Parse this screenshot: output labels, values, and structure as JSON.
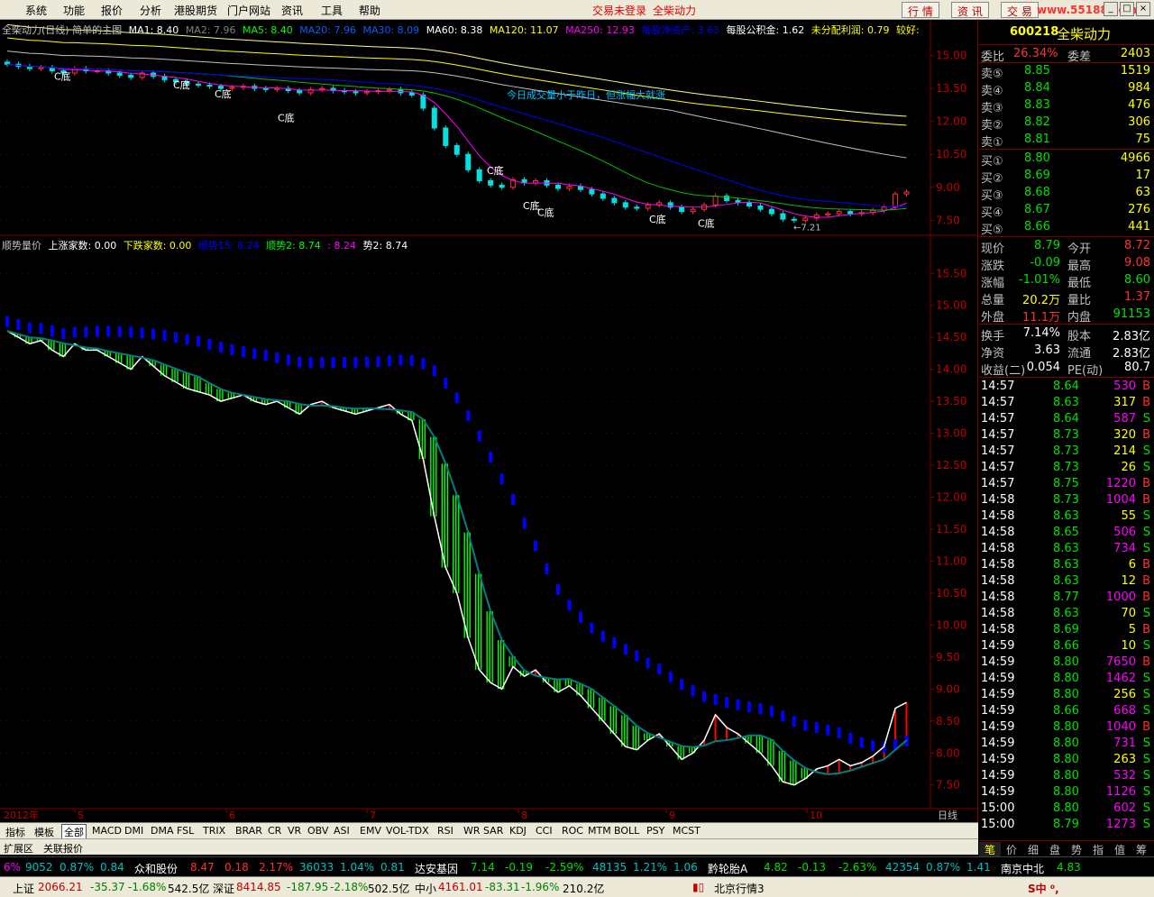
{
  "menu": {
    "items": [
      "系统",
      "功能",
      "报价",
      "分析",
      "港股期货",
      "门户网站",
      "资讯",
      "工具",
      "帮助"
    ],
    "status1": "交易未登录",
    "status2": "全柴动力",
    "right_buttons": [
      "行 情",
      "资 讯",
      "交 易"
    ],
    "watermark": "www.55188.com",
    "window_icons": [
      "minimize-icon",
      "restore-icon",
      "close-icon"
    ]
  },
  "main_header": {
    "title": "全柴动力(日线) 简单的主图",
    "ma1": "MA1: 8.40",
    "ma2": "MA2: 7.96",
    "ma5": "MA5: 8.40",
    "ma20": "MA20: 7.96",
    "ma30": "MA30: 8.09",
    "ma60": "MA60: 8.38",
    "ma120": "MA120: 11.07",
    "ma250": "MA250: 12.93",
    "nav": "每股净资产: 3.63",
    "reserve": "每股公积金: 1.62",
    "undist": "未分配利润: 0.79",
    "rating": "较好:"
  },
  "main_annotations": {
    "c_label": "C底",
    "note": "今日成交量小于昨日，但涨幅大就涨",
    "low_label": "←7.21"
  },
  "sub_header": {
    "title": "顺势量价",
    "up": "上涨家数: 0.00",
    "down": "下跌家数: 0.00",
    "s15": "顺势15: 8.24",
    "s2": "顺势2: 8.74",
    "s3": ": 8.24",
    "s4": "势2: 8.74"
  },
  "chart_data": {
    "type": "candlestick-with-indicator",
    "main_axis": [
      "15.00",
      "13.50",
      "12.00",
      "10.50",
      "9.00",
      "7.50"
    ],
    "sub_axis": [
      "15.50",
      "15.00",
      "14.50",
      "14.00",
      "13.50",
      "13.00",
      "12.50",
      "12.00",
      "11.50",
      "11.00",
      "10.50",
      "10.00",
      "9.50",
      "9.00",
      "8.50",
      "8.00",
      "7.50"
    ],
    "x_labels": [
      "2012年",
      "5",
      "6",
      "7",
      "8",
      "9",
      "10",
      "日线"
    ],
    "main_ylim": [
      6.9,
      15.8
    ],
    "sub_ylim": [
      7.2,
      15.8
    ],
    "close": [
      14.6,
      14.5,
      14.4,
      14.45,
      14.3,
      14.2,
      14.4,
      14.3,
      14.3,
      14.2,
      14.1,
      14.0,
      14.2,
      14.05,
      13.9,
      13.8,
      13.7,
      13.65,
      13.6,
      13.5,
      13.55,
      13.6,
      13.5,
      13.45,
      13.5,
      13.4,
      13.3,
      13.45,
      13.5,
      13.4,
      13.35,
      13.3,
      13.35,
      13.4,
      13.45,
      13.3,
      13.2,
      12.6,
      11.7,
      10.9,
      10.5,
      9.8,
      9.3,
      9.1,
      9.0,
      9.35,
      9.2,
      9.3,
      9.1,
      8.95,
      9.05,
      8.9,
      8.7,
      8.5,
      8.3,
      8.1,
      8.05,
      8.2,
      8.3,
      8.1,
      7.9,
      8.0,
      8.2,
      8.6,
      8.4,
      8.3,
      8.15,
      8.0,
      7.8,
      7.55,
      7.5,
      7.6,
      7.75,
      7.8,
      7.9,
      7.8,
      7.85,
      7.95,
      8.1,
      8.7,
      8.79
    ],
    "ma_series": [
      "MA5",
      "MA20",
      "MA30",
      "MA60",
      "MA120",
      "MA250"
    ],
    "ma_colors": [
      "#ff00ff",
      "#00c000",
      "#0000ff",
      "#c0c0c0",
      "#ffff00",
      "#ffff80"
    ],
    "sub_series": [
      "white-line",
      "teal-line",
      "blue-bars",
      "green-bars"
    ]
  },
  "quote": {
    "code": "600218",
    "name": "全柴动力",
    "ratio_label": "委比",
    "ratio": "26.34%",
    "diff_label": "委差",
    "diff": "2403",
    "sells": [
      {
        "label": "卖⑤",
        "price": "8.85",
        "vol": "1519"
      },
      {
        "label": "卖④",
        "price": "8.84",
        "vol": "984"
      },
      {
        "label": "卖③",
        "price": "8.83",
        "vol": "476"
      },
      {
        "label": "卖②",
        "price": "8.82",
        "vol": "306"
      },
      {
        "label": "卖①",
        "price": "8.81",
        "vol": "75"
      }
    ],
    "buys": [
      {
        "label": "买①",
        "price": "8.80",
        "vol": "4966"
      },
      {
        "label": "买②",
        "price": "8.69",
        "vol": "17"
      },
      {
        "label": "买③",
        "price": "8.68",
        "vol": "63"
      },
      {
        "label": "买④",
        "price": "8.67",
        "vol": "276"
      },
      {
        "label": "买⑤",
        "price": "8.66",
        "vol": "441"
      }
    ],
    "stats": [
      [
        "现价",
        "8.79",
        "今开",
        "8.72",
        "dn",
        "up"
      ],
      [
        "涨跌",
        "-0.09",
        "最高",
        "9.08",
        "dn",
        "up"
      ],
      [
        "涨幅",
        "-1.01%",
        "最低",
        "8.60",
        "dn",
        "dn"
      ],
      [
        "总量",
        "20.2万",
        "量比",
        "1.37",
        "yl",
        "up"
      ],
      [
        "外盘",
        "11.1万",
        "内盘",
        "91153",
        "up",
        "dn"
      ]
    ],
    "stats2": [
      [
        "换手",
        "7.14%",
        "股本",
        "2.83亿"
      ],
      [
        "净资",
        "3.63",
        "流通",
        "2.83亿"
      ],
      [
        "收益(二)",
        "0.054",
        "PE(动)",
        "80.7"
      ]
    ],
    "ticks": [
      [
        "14:57",
        "8.64",
        "530",
        "B",
        "dn",
        "mg"
      ],
      [
        "14:57",
        "8.63",
        "317",
        "B",
        "dn",
        "yl"
      ],
      [
        "14:57",
        "8.64",
        "587",
        "S",
        "dn",
        "mg"
      ],
      [
        "14:57",
        "8.73",
        "320",
        "B",
        "dn",
        "yl"
      ],
      [
        "14:57",
        "8.73",
        "214",
        "S",
        "dn",
        "yl"
      ],
      [
        "14:57",
        "8.73",
        "26",
        "S",
        "dn",
        "yl"
      ],
      [
        "14:57",
        "8.75",
        "1220",
        "B",
        "dn",
        "mg"
      ],
      [
        "14:58",
        "8.73",
        "1004",
        "B",
        "dn",
        "mg"
      ],
      [
        "14:58",
        "8.63",
        "55",
        "S",
        "dn",
        "yl"
      ],
      [
        "14:58",
        "8.65",
        "506",
        "S",
        "dn",
        "mg"
      ],
      [
        "14:58",
        "8.63",
        "734",
        "S",
        "dn",
        "mg"
      ],
      [
        "14:58",
        "8.63",
        "6",
        "B",
        "dn",
        "yl"
      ],
      [
        "14:58",
        "8.63",
        "12",
        "B",
        "dn",
        "yl"
      ],
      [
        "14:58",
        "8.77",
        "1000",
        "B",
        "dn",
        "mg"
      ],
      [
        "14:58",
        "8.63",
        "70",
        "S",
        "dn",
        "yl"
      ],
      [
        "14:58",
        "8.69",
        "5",
        "B",
        "dn",
        "yl"
      ],
      [
        "14:59",
        "8.66",
        "10",
        "S",
        "dn",
        "yl"
      ],
      [
        "14:59",
        "8.80",
        "7650",
        "B",
        "dn",
        "mg"
      ],
      [
        "14:59",
        "8.80",
        "1462",
        "S",
        "dn",
        "mg"
      ],
      [
        "14:59",
        "8.80",
        "256",
        "S",
        "dn",
        "yl"
      ],
      [
        "14:59",
        "8.66",
        "668",
        "S",
        "dn",
        "mg"
      ],
      [
        "14:59",
        "8.80",
        "1040",
        "B",
        "dn",
        "mg"
      ],
      [
        "14:59",
        "8.80",
        "731",
        "S",
        "dn",
        "mg"
      ],
      [
        "14:59",
        "8.80",
        "263",
        "S",
        "dn",
        "yl"
      ],
      [
        "14:59",
        "8.80",
        "532",
        "S",
        "dn",
        "mg"
      ],
      [
        "14:59",
        "8.80",
        "1126",
        "S",
        "dn",
        "mg"
      ],
      [
        "15:00",
        "8.80",
        "602",
        "S",
        "dn",
        "mg"
      ],
      [
        "15:00",
        "8.79",
        "1273",
        "S",
        "dn",
        "mg"
      ]
    ]
  },
  "right_tabs": [
    "笔",
    "价",
    "细",
    "盘",
    "势",
    "指",
    "值",
    "筹"
  ],
  "indicators": [
    "指标",
    "模板",
    "全部",
    "MACD",
    "DMI",
    "DMA",
    "FSL",
    "TRIX",
    "BRAR",
    "CR",
    "VR",
    "OBV",
    "ASI",
    "EMV",
    "VOL-TDX",
    "RSI",
    "WR",
    "SAR",
    "KDJ",
    "CCI",
    "ROC",
    "MTM",
    "BOLL",
    "PSY",
    "MCST"
  ],
  "ext_tabs": [
    "扩展区",
    "关联报价"
  ],
  "ticker": [
    {
      "t": "6%",
      "c": "mg"
    },
    {
      "t": "9052",
      "c": "cy"
    },
    {
      "t": "0.87%",
      "c": "cy"
    },
    {
      "t": "0.84",
      "c": "cy"
    },
    {
      "t": "众和股份",
      "c": "wh"
    },
    {
      "t": "8.47",
      "c": "up"
    },
    {
      "t": "0.18",
      "c": "up"
    },
    {
      "t": "2.17%",
      "c": "up"
    },
    {
      "t": "36033",
      "c": "cy"
    },
    {
      "t": "1.04%",
      "c": "cy"
    },
    {
      "t": "0.81",
      "c": "cy"
    },
    {
      "t": "达安基因",
      "c": "wh"
    },
    {
      "t": "7.14",
      "c": "dn"
    },
    {
      "t": "-0.19",
      "c": "dn"
    },
    {
      "t": "-2.59%",
      "c": "dn"
    },
    {
      "t": "48135",
      "c": "cy"
    },
    {
      "t": "1.21%",
      "c": "cy"
    },
    {
      "t": "1.06",
      "c": "cy"
    },
    {
      "t": "黔轮胎A",
      "c": "wh"
    },
    {
      "t": "4.82",
      "c": "dn"
    },
    {
      "t": "-0.13",
      "c": "dn"
    },
    {
      "t": "-2.63%",
      "c": "dn"
    },
    {
      "t": "42354",
      "c": "cy"
    },
    {
      "t": "0.87%",
      "c": "cy"
    },
    {
      "t": "1.41",
      "c": "cy"
    },
    {
      "t": "南京中北",
      "c": "wh"
    },
    {
      "t": "4.83",
      "c": "dn"
    }
  ],
  "bottom": {
    "sh_label": "上证",
    "sh": "2066.21",
    "sh_chg": "-35.37",
    "sh_pct": "-1.68%",
    "sh_amt": "542.5亿",
    "sz_label": "深证",
    "sz": "8414.85",
    "sz_chg": "-187.95",
    "sz_pct": "-2.18%",
    "sz_amt": "502.5亿",
    "zx_label": "中小",
    "zx": "4161.01",
    "zx_chg": "-83.31",
    "zx_pct": "-1.96%",
    "zx_amt": "210.2亿",
    "site": "北京行情3"
  }
}
